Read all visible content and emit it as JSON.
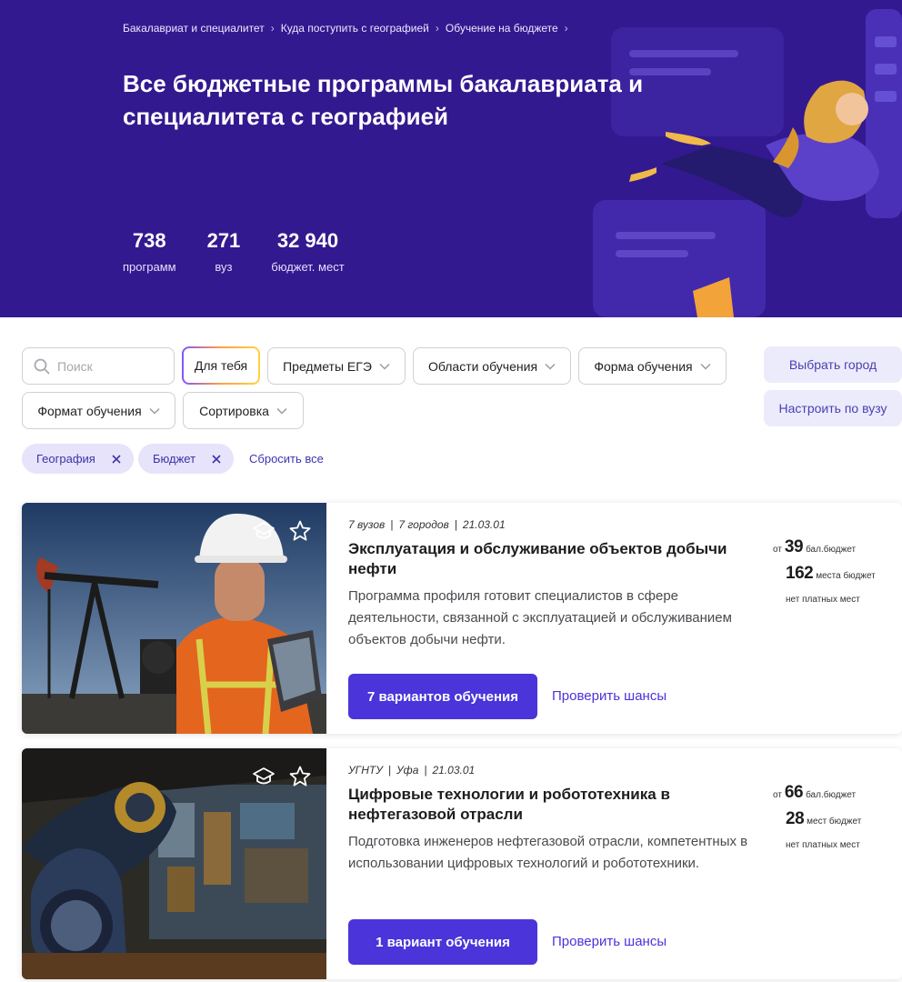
{
  "hero": {
    "breadcrumb": [
      "Бакалавриат и специалитет",
      "Куда поступить с географией",
      "Обучение на бюджете"
    ],
    "title": "Все бюджетные программы бакалавриата и специалитета с географией",
    "stats": [
      {
        "value": "738",
        "label": "программ"
      },
      {
        "value": "271",
        "label": "вуз"
      },
      {
        "value": "32 940",
        "label": "бюджет. мест"
      }
    ],
    "bg_color": "#33198f"
  },
  "filters": {
    "search_placeholder": "Поиск",
    "for_you": "Для тебя",
    "ege": "Предметы ЕГЭ",
    "areas": "Области обучения",
    "form": "Форма обучения",
    "format": "Формат обучения",
    "sort": "Сортировка",
    "choose_city": "Выбрать город",
    "by_university": "Настроить по вузу",
    "active_tags": [
      "География",
      "Бюджет"
    ],
    "reset": "Сбросить все"
  },
  "cards": [
    {
      "meta": [
        "7 вузов",
        "7 городов",
        "21.03.01"
      ],
      "title": "Эксплуатация и обслуживание объектов добычи нефти",
      "description": "Программа профиля готовит специалистов в сфере деятельности, связанной с эксплуатацией и обслуживанием объектов добычи нефти.",
      "options_button": "7 вариантов обучения",
      "chances_link": "Проверить шансы",
      "score_prefix": "от",
      "score": "39",
      "score_label": "бал.бюджет",
      "places": "162",
      "places_label": "места бюджет",
      "paid": "нет платных мест"
    },
    {
      "meta": [
        "УГНТУ",
        "Уфа",
        "21.03.01"
      ],
      "title": "Цифровые технологии и робототехника в нефтегазовой отрасли",
      "description": "Подготовка инженеров нефтегазовой отрасли, компетентных в использовании цифровых технологий и робототехники.",
      "options_button": "1 вариант обучения",
      "chances_link": "Проверить шансы",
      "score_prefix": "от",
      "score": "66",
      "score_label": "бал.бюджет",
      "places": "28",
      "places_label": "мест бюджет",
      "paid": "нет платных мест"
    }
  ],
  "colors": {
    "accent": "#4b34d9",
    "tag_bg": "#e6e3fb"
  }
}
